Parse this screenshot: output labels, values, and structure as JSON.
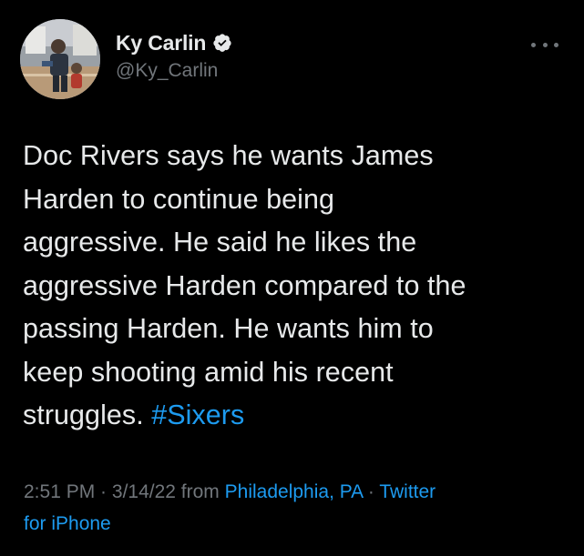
{
  "author": {
    "display_name": "Ky Carlin",
    "handle": "@Ky_Carlin",
    "verified": true,
    "avatar_icon": "profile-photo"
  },
  "more_icon": "more-horizontal-icon",
  "tweet": {
    "text_lines": [
      "Doc Rivers says he wants James",
      "Harden to continue being",
      "aggressive. He said he likes the",
      "aggressive Harden compared to the",
      "passing Harden. He wants him to",
      "keep shooting amid his recent",
      "struggles."
    ],
    "hashtag": "#Sixers"
  },
  "meta": {
    "time": "2:51 PM",
    "sep1": " · ",
    "date": "3/14/22",
    "from": " from ",
    "location": "Philadelphia, PA",
    "sep2": " · ",
    "source_part1": "Twitter",
    "source_part2": "for iPhone"
  },
  "colors": {
    "background": "#000000",
    "text": "#e7e9ea",
    "secondary": "#71767b",
    "accent": "#1d9bf0"
  }
}
